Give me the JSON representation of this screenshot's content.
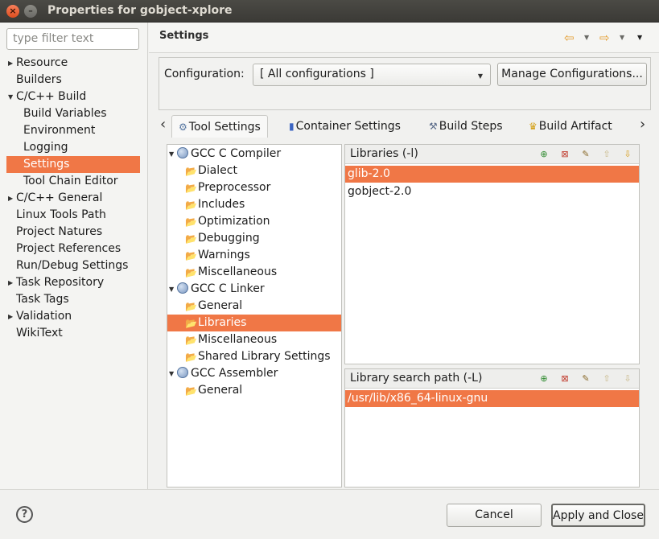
{
  "window": {
    "title": "Properties for gobject-xplore",
    "close_glyph": "×",
    "minimize_glyph": "–"
  },
  "filter": {
    "placeholder": "type filter text"
  },
  "sidebar": {
    "items": [
      {
        "label": "Resource",
        "expandable": true
      },
      {
        "label": "Builders"
      },
      {
        "label": "C/C++ Build",
        "expanded": true
      },
      {
        "label": "Build Variables"
      },
      {
        "label": "Environment"
      },
      {
        "label": "Logging"
      },
      {
        "label": "Settings",
        "selected": true
      },
      {
        "label": "Tool Chain Editor"
      },
      {
        "label": "C/C++ General",
        "expandable": true
      },
      {
        "label": "Linux Tools Path"
      },
      {
        "label": "Project Natures"
      },
      {
        "label": "Project References"
      },
      {
        "label": "Run/Debug Settings"
      },
      {
        "label": "Task Repository",
        "expandable": true
      },
      {
        "label": "Task Tags"
      },
      {
        "label": "Validation",
        "expandable": true
      },
      {
        "label": "WikiText"
      }
    ]
  },
  "header": {
    "title": "Settings",
    "icons": [
      "back-arrow-icon",
      "chevron-down-icon",
      "forward-arrow-icon",
      "chevron-down-icon",
      "view-menu-icon"
    ]
  },
  "configuration": {
    "label": "Configuration:",
    "value": "[ All configurations ]",
    "manage_label": "Manage Configurations..."
  },
  "tabs": [
    {
      "label": "Tool Settings",
      "icon": "tool-settings-icon",
      "active": true
    },
    {
      "label": "Container Settings",
      "icon": "container-icon"
    },
    {
      "label": "Build Steps",
      "icon": "build-steps-icon"
    },
    {
      "label": "Build Artifact",
      "icon": "trophy-icon"
    }
  ],
  "tool_tree": [
    {
      "label": "GCC C Compiler",
      "level": 0
    },
    {
      "label": "Dialect",
      "level": 1
    },
    {
      "label": "Preprocessor",
      "level": 1
    },
    {
      "label": "Includes",
      "level": 1
    },
    {
      "label": "Optimization",
      "level": 1
    },
    {
      "label": "Debugging",
      "level": 1
    },
    {
      "label": "Warnings",
      "level": 1
    },
    {
      "label": "Miscellaneous",
      "level": 1
    },
    {
      "label": "GCC C Linker",
      "level": 0
    },
    {
      "label": "General",
      "level": 1
    },
    {
      "label": "Libraries",
      "level": 1,
      "selected": true
    },
    {
      "label": "Miscellaneous",
      "level": 1
    },
    {
      "label": "Shared Library Settings",
      "level": 1
    },
    {
      "label": "GCC Assembler",
      "level": 0
    },
    {
      "label": "General",
      "level": 1
    }
  ],
  "libraries": {
    "title": "Libraries (-l)",
    "items": [
      "glib-2.0",
      "gobject-2.0"
    ],
    "selected_index": 0
  },
  "search_path": {
    "title": "Library search path (-L)",
    "items": [
      "/usr/lib/x86_64-linux-gnu"
    ],
    "selected_index": 0
  },
  "list_toolbar_icons": [
    "add-icon",
    "delete-icon",
    "edit-icon",
    "move-up-icon",
    "move-down-icon"
  ],
  "footer": {
    "help_glyph": "?",
    "cancel_label": "Cancel",
    "apply_label": "Apply and Close"
  },
  "colors": {
    "selection": "#f07746",
    "titlebar": "#3c3b37"
  }
}
